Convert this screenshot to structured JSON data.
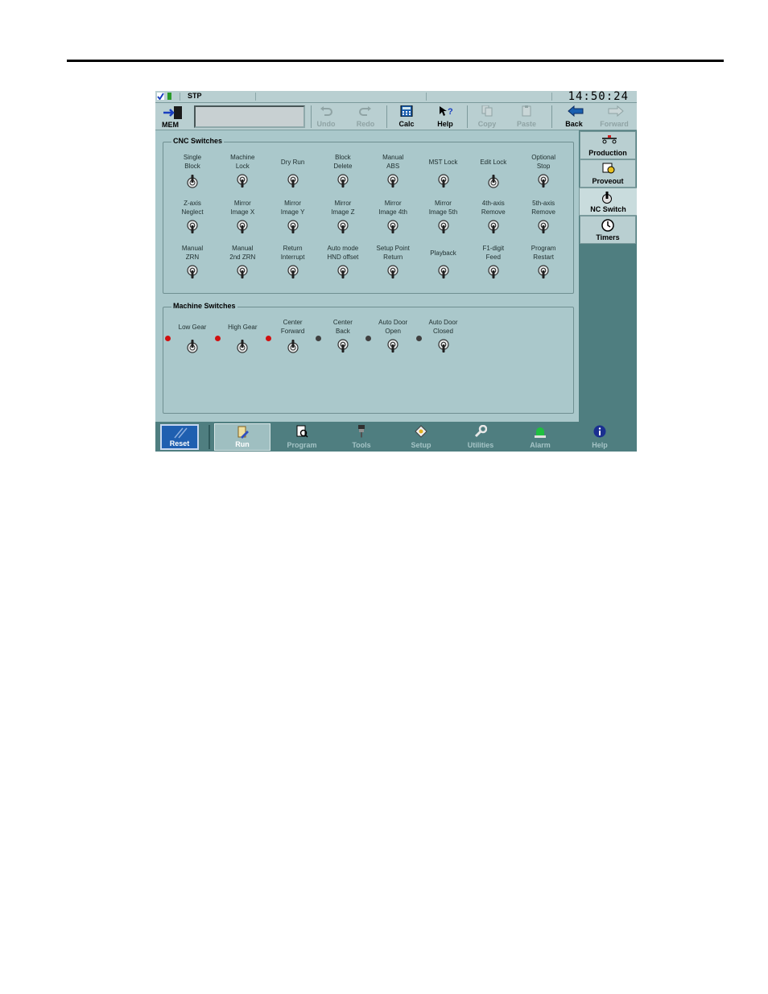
{
  "clock": "14:50:24",
  "status": {
    "mode": "STP"
  },
  "mode_button": {
    "label": "MEM"
  },
  "toolbar": {
    "undo": "Undo",
    "redo": "Redo",
    "calc": "Calc",
    "help": "Help",
    "copy": "Copy",
    "paste": "Paste",
    "back": "Back",
    "forward": "Forward"
  },
  "cnc_group_title": "CNC Switches",
  "machine_group_title": "Machine Switches",
  "cnc_switches": [
    {
      "label": "Single\nBlock",
      "state": "on"
    },
    {
      "label": "Machine\nLock",
      "state": "off"
    },
    {
      "label": "Dry Run",
      "state": "off"
    },
    {
      "label": "Block\nDelete",
      "state": "off"
    },
    {
      "label": "Manual\nABS",
      "state": "off"
    },
    {
      "label": "MST Lock",
      "state": "off"
    },
    {
      "label": "Edit Lock",
      "state": "on"
    },
    {
      "label": "Optional\nStop",
      "state": "off"
    },
    {
      "label": "Z-axis\nNeglect",
      "state": "off"
    },
    {
      "label": "Mirror\nImage X",
      "state": "off"
    },
    {
      "label": "Mirror\nImage Y",
      "state": "off"
    },
    {
      "label": "Mirror\nImage Z",
      "state": "off"
    },
    {
      "label": "Mirror\nImage 4th",
      "state": "off"
    },
    {
      "label": "Mirror\nImage 5th",
      "state": "off"
    },
    {
      "label": "4th-axis\nRemove",
      "state": "off"
    },
    {
      "label": "5th-axis\nRemove",
      "state": "off"
    },
    {
      "label": "Manual\nZRN",
      "state": "off"
    },
    {
      "label": "Manual\n2nd ZRN",
      "state": "off"
    },
    {
      "label": "Return\nInterrupt",
      "state": "off"
    },
    {
      "label": "Auto mode\nHND offset",
      "state": "off"
    },
    {
      "label": "Setup Point\nReturn",
      "state": "off"
    },
    {
      "label": "Playback",
      "state": "off"
    },
    {
      "label": "F1-digit\nFeed",
      "state": "off"
    },
    {
      "label": "Program\nRestart",
      "state": "off"
    }
  ],
  "machine_switches": [
    {
      "label": "Low Gear",
      "state": "on",
      "led": "on"
    },
    {
      "label": "High Gear",
      "state": "on",
      "led": "on"
    },
    {
      "label": "Center\nForward",
      "state": "on",
      "led": "on"
    },
    {
      "label": "Center\nBack",
      "state": "off",
      "led": "off"
    },
    {
      "label": "Auto Door\nOpen",
      "state": "off",
      "led": "off"
    },
    {
      "label": "Auto Door\nClosed",
      "state": "off",
      "led": "off"
    }
  ],
  "side_tabs": [
    "Production",
    "Proveout",
    "NC Switch",
    "Timers"
  ],
  "side_tab_active": "NC Switch",
  "bottom": {
    "reset": "Reset",
    "nav": [
      "Run",
      "Program",
      "Tools",
      "Setup",
      "Utilities",
      "Alarm",
      "Help"
    ],
    "active": "Run"
  },
  "colors": {
    "panel": "#aac8cb",
    "frame": "#4f7e80",
    "led_on": "#d01010",
    "reset": "#1f5fb0"
  }
}
